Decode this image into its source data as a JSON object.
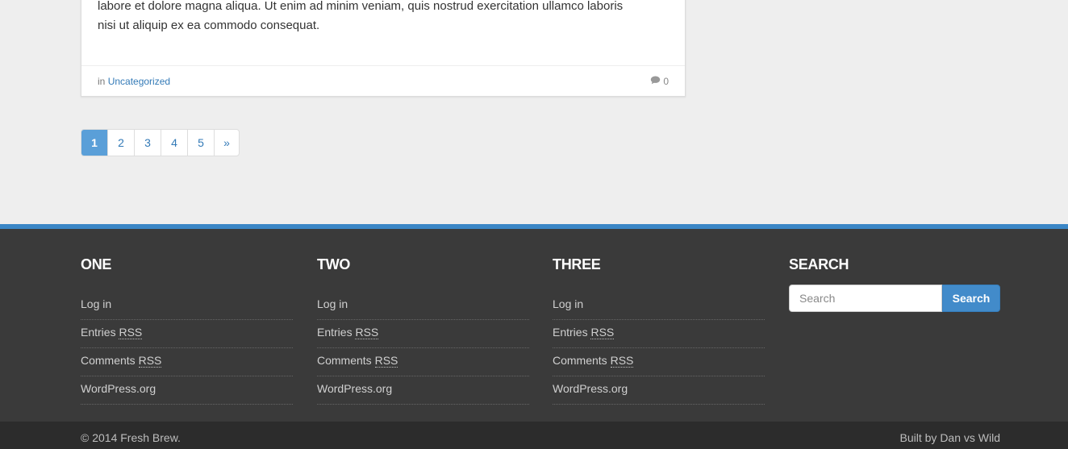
{
  "post": {
    "excerpt_line1": "labore et dolore magna aliqua. Ut enim ad minim veniam, quis nostrud exercitation ullamco laboris",
    "excerpt_line2": "nisi ut aliquip ex ea commodo consequat.",
    "meta_prefix": "in",
    "category": "Uncategorized",
    "comment_count": "0",
    "comment_icon": "comment-icon"
  },
  "pagination": {
    "pages": [
      "1",
      "2",
      "3",
      "4",
      "5"
    ],
    "active": "1",
    "next": "»"
  },
  "footer": {
    "columns": [
      {
        "title": "ONE",
        "items": [
          "Log in",
          "Entries",
          "Comments",
          "WordPress.org"
        ]
      },
      {
        "title": "TWO",
        "items": [
          "Log in",
          "Entries",
          "Comments",
          "WordPress.org"
        ]
      },
      {
        "title": "THREE",
        "items": [
          "Log in",
          "Entries",
          "Comments",
          "WordPress.org"
        ]
      }
    ],
    "rss_label": "RSS",
    "search": {
      "title": "SEARCH",
      "placeholder": "Search",
      "button_label": "Search"
    }
  },
  "bottom": {
    "copyright": "© 2014 Fresh Brew.",
    "credit": "Built by Dan vs Wild"
  },
  "colors": {
    "accent": "#3a86c6",
    "footer_bg": "#3a3a3a",
    "active_page": "#5a9fd8"
  }
}
